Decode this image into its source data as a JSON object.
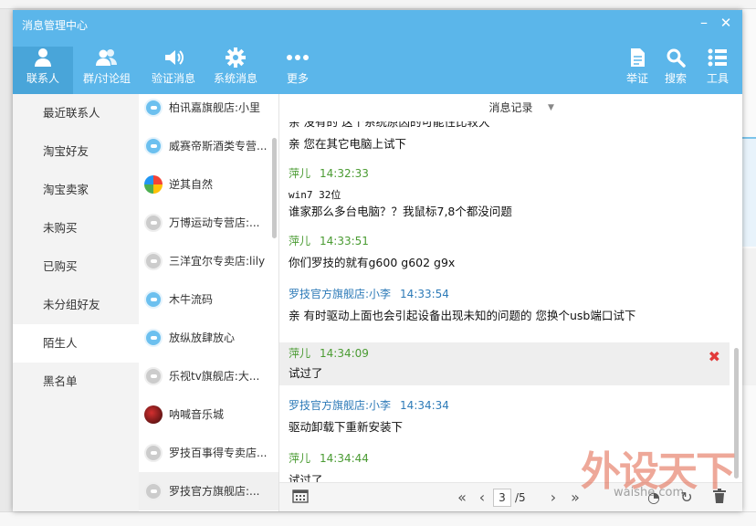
{
  "window": {
    "title": "消息管理中心"
  },
  "nav": {
    "left": [
      {
        "label": "联系人",
        "icon": "person-icon"
      },
      {
        "label": "群/讨论组",
        "icon": "group-icon"
      },
      {
        "label": "验证消息",
        "icon": "speaker-icon"
      },
      {
        "label": "系统消息",
        "icon": "gear-icon"
      },
      {
        "label": "更多",
        "icon": "more-dots-icon"
      }
    ],
    "right": [
      {
        "label": "举证",
        "icon": "document-icon"
      },
      {
        "label": "搜索",
        "icon": "search-icon"
      },
      {
        "label": "工具",
        "icon": "list-icon"
      }
    ]
  },
  "categories": [
    "最近联系人",
    "淘宝好友",
    "淘宝卖家",
    "未购买",
    "已购买",
    "未分组好友",
    "陌生人",
    "黑名单"
  ],
  "contacts": [
    "柏讯嘉旗舰店:小里",
    "威赛帝斯酒类专营...",
    "逆其自然",
    "万博运动专营店:...",
    "三洋宜尔专卖店:lily",
    "木牛流码",
    "放纵放肆放心",
    "乐视tv旗舰店:大...",
    "呐喊音乐城",
    "罗技百事得专卖店...",
    "罗技官方旗舰店:..."
  ],
  "chat": {
    "header": "消息记录",
    "partial_line": "亲 没有的 这个系统原因的可能性比较大",
    "messages": [
      {
        "sender": "",
        "time": "",
        "text": "亲 您在其它电脑上试下"
      },
      {
        "sender": "萍儿",
        "time": "14:32:33",
        "lines": [
          "win7  32位",
          "谁家那么多台电脑？？我鼠标7,8个都没问题"
        ]
      },
      {
        "sender": "萍儿",
        "time": "14:33:51",
        "text": "你们罗技的就有g600  g602  g9x"
      },
      {
        "sender": "罗技官方旗舰店:小李",
        "time": "14:33:54",
        "text": "亲  有时驱动上面也会引起设备出现未知的问题的 您换个usb端口试下"
      },
      {
        "sender": "萍儿",
        "time": "14:34:09",
        "text": "试过了"
      },
      {
        "sender": "罗技官方旗舰店:小李",
        "time": "14:34:34",
        "text": "驱动卸载下重新安装下"
      },
      {
        "sender": "萍儿",
        "time": "14:34:44",
        "text": "试过了"
      }
    ],
    "pager": {
      "current": "3",
      "total": "/5"
    }
  },
  "watermark": {
    "big": "外设天下",
    "small": "waishe.com"
  },
  "colors": {
    "header_blue": "#5bb6ea",
    "buyer_green": "#4a9b32",
    "seller_blue": "#2e7bb8",
    "delete_red": "#e23b3b"
  }
}
